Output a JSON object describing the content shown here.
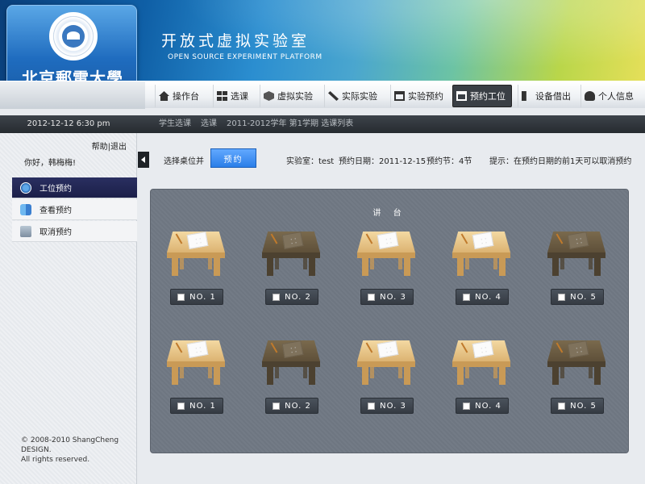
{
  "header": {
    "university_name": "北京郵電大學",
    "site_title": "开放式虚拟实验室",
    "site_subtitle": "OPEN  SOURCE EXPERIMENT PLATFORM"
  },
  "nav": {
    "items": [
      {
        "label": "操作台",
        "icon": "home-icon"
      },
      {
        "label": "选课",
        "icon": "grid-icon"
      },
      {
        "label": "虚拟实验",
        "icon": "cube-icon"
      },
      {
        "label": "实际实验",
        "icon": "tools-icon"
      },
      {
        "label": "实验预约",
        "icon": "calendar-icon"
      },
      {
        "label": "预约工位",
        "icon": "calendar-icon",
        "active": true
      },
      {
        "label": "设备借出",
        "icon": "book-icon"
      },
      {
        "label": "个人信息",
        "icon": "user-icon"
      }
    ]
  },
  "infobar": {
    "datetime": "2012-12-12    6:30 pm",
    "breadcrumb": [
      "学生选课",
      "选课",
      "2011-2012学年  第1学期  选课列表"
    ]
  },
  "sidebar": {
    "help": "帮助",
    "logout": "退出",
    "separator": "|",
    "greeting": "你好，韩梅梅!",
    "items": [
      {
        "label": "工位预约",
        "icon": "info-icon",
        "active": true
      },
      {
        "label": "查看预约",
        "icon": "finder-icon"
      },
      {
        "label": "取消预约",
        "icon": "trash-icon"
      }
    ],
    "copyright_line1": "© 2008-2010 ShangCheng DESIGN.",
    "copyright_line2": "All rights reserved."
  },
  "toolbar": {
    "select_label": "选择桌位并",
    "reserve_button": "预约",
    "lab": "实验室：test",
    "date": "预约日期：2011-12-15",
    "session": "预约节：4节",
    "hint": "提示：在预约日期的前1天可以取消预约"
  },
  "lab": {
    "lectern": "讲 台",
    "rows": [
      {
        "desks": [
          {
            "label": "NO. 1",
            "status": "free"
          },
          {
            "label": "NO. 2",
            "status": "taken"
          },
          {
            "label": "NO. 3",
            "status": "free"
          },
          {
            "label": "NO. 4",
            "status": "free"
          },
          {
            "label": "NO. 5",
            "status": "taken"
          }
        ]
      },
      {
        "desks": [
          {
            "label": "NO. 1",
            "status": "free"
          },
          {
            "label": "NO. 2",
            "status": "taken"
          },
          {
            "label": "NO. 3",
            "status": "free"
          },
          {
            "label": "NO. 4",
            "status": "free"
          },
          {
            "label": "NO. 5",
            "status": "taken"
          }
        ]
      }
    ]
  },
  "colors": {
    "active_nav": "#3a3f45",
    "reserve_button": "#3b8cf2",
    "sidebar_active": "#1f2352",
    "desk_free": "#e6c48a",
    "desk_taken": "#5e5039"
  }
}
